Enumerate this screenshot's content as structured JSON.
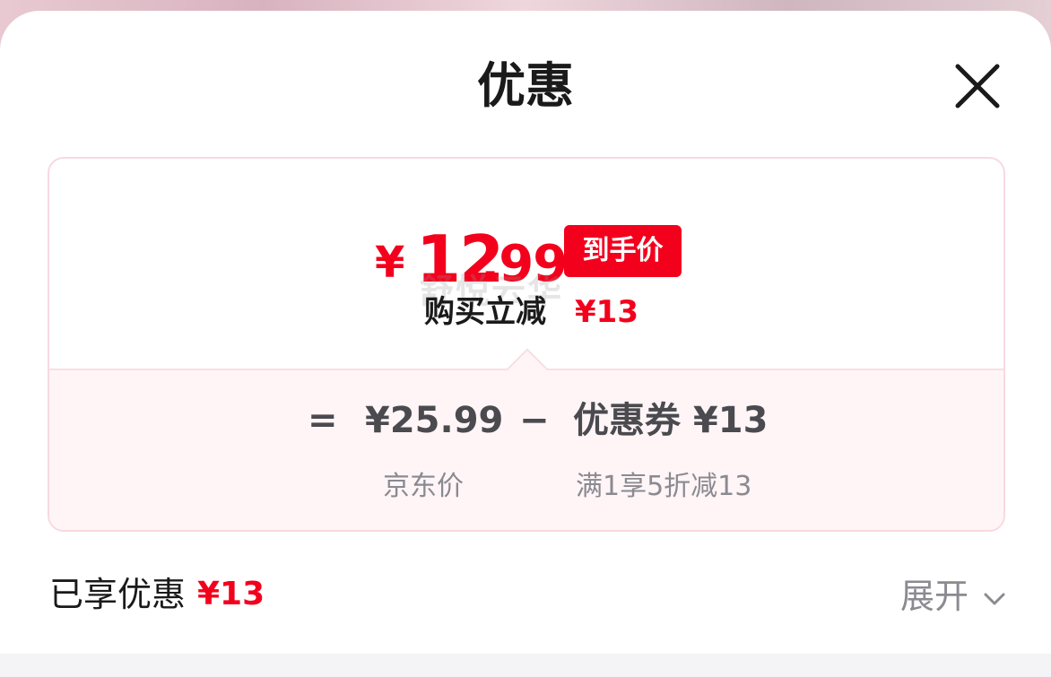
{
  "sheet": {
    "title": "优惠",
    "close_icon": "close-icon"
  },
  "price_card": {
    "yen_symbol": "¥",
    "final_price_int": "12",
    "final_price_dec": ".99",
    "badge": "到手价",
    "promo_label": "购买立减",
    "promo_amount": "¥13",
    "watermark": "舒悦云华",
    "breakdown": {
      "equals": "=",
      "original_price": "¥25.99",
      "original_price_label": "京东价",
      "minus": "−",
      "coupon": "优惠券 ¥13",
      "coupon_rule": "满1享5折减13"
    }
  },
  "footer": {
    "enjoyed_label": "已享优惠",
    "enjoyed_amount": "¥13",
    "expand_label": "展开",
    "expand_icon": "chevron-down-icon"
  },
  "colors": {
    "accent": "#f3001d",
    "card_border": "#f8d9e0",
    "card_tint": "#fff5f7",
    "muted_text": "#8a8a90"
  }
}
